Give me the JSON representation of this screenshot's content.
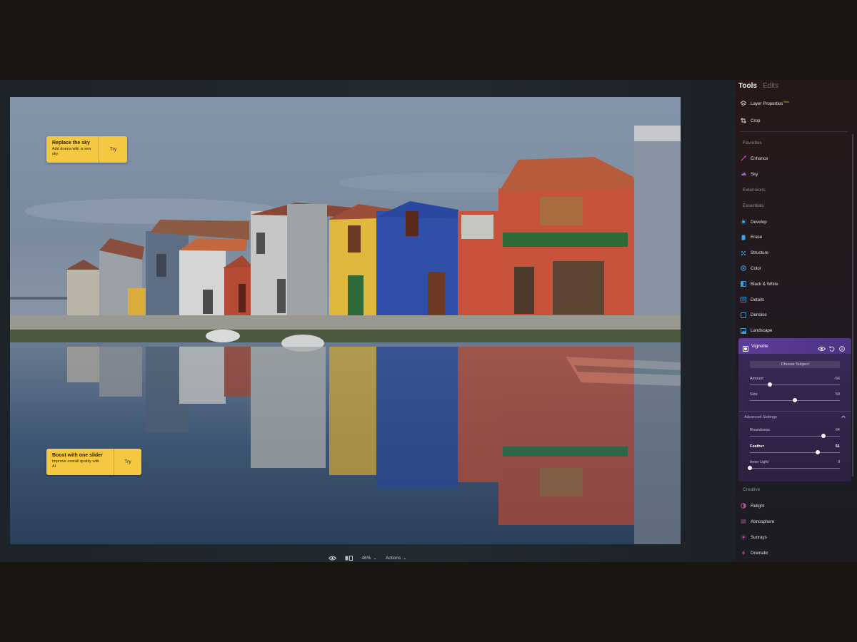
{
  "panel": {
    "tab_tools": "Tools",
    "tab_edits": "Edits",
    "top_items": [
      {
        "label": "Layer Properties",
        "badge": "Beta",
        "icon": "layers-icon"
      },
      {
        "label": "Crop",
        "badge": "",
        "icon": "crop-icon"
      }
    ],
    "favorites_label": "Favorites",
    "favorites": [
      {
        "label": "Enhance",
        "icon": "enhance-icon",
        "color": "#c44aa8"
      },
      {
        "label": "Sky",
        "icon": "sky-icon",
        "color": "#9a5ad6"
      }
    ],
    "extensions_label": "Extensions",
    "essentials_label": "Essentials",
    "essentials": [
      {
        "label": "Develop",
        "icon": "develop-icon",
        "color": "#3aa0e8"
      },
      {
        "label": "Erase",
        "icon": "erase-icon",
        "color": "#3aa0e8"
      },
      {
        "label": "Structure",
        "icon": "structure-icon",
        "color": "#3aa0e8"
      },
      {
        "label": "Color",
        "icon": "color-icon",
        "color": "#3aa0e8"
      },
      {
        "label": "Black & White",
        "icon": "black-white-icon",
        "color": "#3aa0e8"
      },
      {
        "label": "Details",
        "icon": "details-icon",
        "color": "#3aa0e8"
      },
      {
        "label": "Denoise",
        "icon": "denoise-icon",
        "color": "#3aa0e8"
      },
      {
        "label": "Landscape",
        "icon": "landscape-icon",
        "color": "#3aa0e8"
      }
    ],
    "vignette": {
      "title": "Vignette",
      "choose_subject": "Choose Subject",
      "sliders": [
        {
          "label": "Amount",
          "value": "-56",
          "position": 0.22
        },
        {
          "label": "Size",
          "value": "50",
          "position": 0.5
        }
      ],
      "advanced_label": "Advanced Settings",
      "advanced_sliders": [
        {
          "label": "Roundness",
          "value": "64",
          "position": 0.82,
          "bold": false
        },
        {
          "label": "Feather",
          "value": "51",
          "position": 0.75,
          "bold": true
        },
        {
          "label": "Inner Light",
          "value": "0",
          "position": 0.0,
          "bold": false
        }
      ]
    },
    "creative_label": "Creative",
    "creative": [
      {
        "label": "Relight",
        "icon": "relight-icon",
        "color": "#c44aa8"
      },
      {
        "label": "Atmosphere",
        "icon": "atmosphere-icon",
        "color": "#c44aa8"
      },
      {
        "label": "Sunrays",
        "icon": "sunrays-icon",
        "color": "#c44aa8"
      },
      {
        "label": "Dramatic",
        "icon": "dramatic-icon",
        "color": "#c44aa8"
      }
    ]
  },
  "canvas": {
    "promo_sky": {
      "title": "Replace the sky",
      "subtitle": "Add drama with a new sky",
      "button": "Try"
    },
    "promo_boost": {
      "title": "Boost with one slider",
      "subtitle": "Improve overall quality with AI",
      "button": "Try"
    }
  },
  "bottom_bar": {
    "zoom": "46%",
    "actions": "Actions"
  },
  "colors": {
    "promo": "#f5c842",
    "vignette_header": "#5d3c99",
    "accent_blue": "#3aa0e8"
  }
}
